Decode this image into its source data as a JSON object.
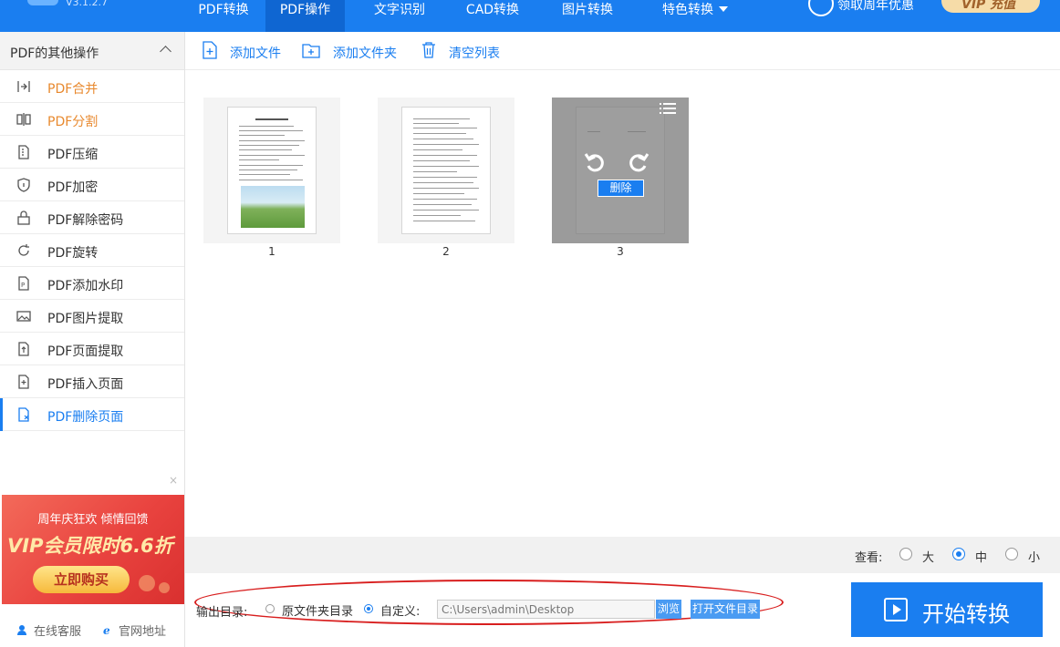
{
  "app": {
    "version": "V3.1.2.7"
  },
  "nav": {
    "tabs": [
      {
        "label": "PDF转换"
      },
      {
        "label": "PDF操作"
      },
      {
        "label": "文字识别"
      },
      {
        "label": "CAD转换"
      },
      {
        "label": "图片转换"
      },
      {
        "label": "特色转换"
      }
    ],
    "active_tab": "PDF操作",
    "promo": "领取周年优惠",
    "vip_button": "VIP 充值"
  },
  "sidebar": {
    "header": "PDF的其他操作",
    "items": [
      {
        "label": "PDF合并",
        "icon": "merge-icon"
      },
      {
        "label": "PDF分割",
        "icon": "split-icon"
      },
      {
        "label": "PDF压缩",
        "icon": "compress-icon"
      },
      {
        "label": "PDF加密",
        "icon": "shield-icon"
      },
      {
        "label": "PDF解除密码",
        "icon": "unlock-icon"
      },
      {
        "label": "PDF旋转",
        "icon": "rotate-icon"
      },
      {
        "label": "PDF添加水印",
        "icon": "watermark-icon"
      },
      {
        "label": "PDF图片提取",
        "icon": "image-icon"
      },
      {
        "label": "PDF页面提取",
        "icon": "page-extract-icon"
      },
      {
        "label": "PDF插入页面",
        "icon": "page-insert-icon"
      },
      {
        "label": "PDF删除页面",
        "icon": "page-delete-icon"
      }
    ],
    "selected": "PDF删除页面",
    "ad": {
      "close": "×",
      "line1": "周年庆狂欢 倾情回馈",
      "line2": "VIP会员限时6.6折",
      "button": "立即购买"
    },
    "footer": {
      "service": "在线客服",
      "website": "官网地址"
    }
  },
  "toolbar": {
    "add_file": "添加文件",
    "add_folder": "添加文件夹",
    "clear_list": "清空列表"
  },
  "pages": [
    {
      "number": "1"
    },
    {
      "number": "2"
    },
    {
      "number": "3"
    }
  ],
  "page_overlay": {
    "delete_label": "删除"
  },
  "view": {
    "label": "查看:",
    "options": [
      "大",
      "中",
      "小"
    ],
    "selected": "中"
  },
  "output": {
    "label": "输出目录:",
    "option_source": "原文件夹目录",
    "option_custom": "自定义:",
    "selected": "自定义",
    "path": "C:\\Users\\admin\\Desktop",
    "browse": "浏览",
    "open_dir": "打开文件目录"
  },
  "start_button": "开始转换",
  "colors": {
    "primary": "#1a7ef0",
    "active_tab": "#0f66d2",
    "orange_text": "#e8892e",
    "annotation_red": "#d81e1e",
    "ad_red": "#e9433f"
  }
}
